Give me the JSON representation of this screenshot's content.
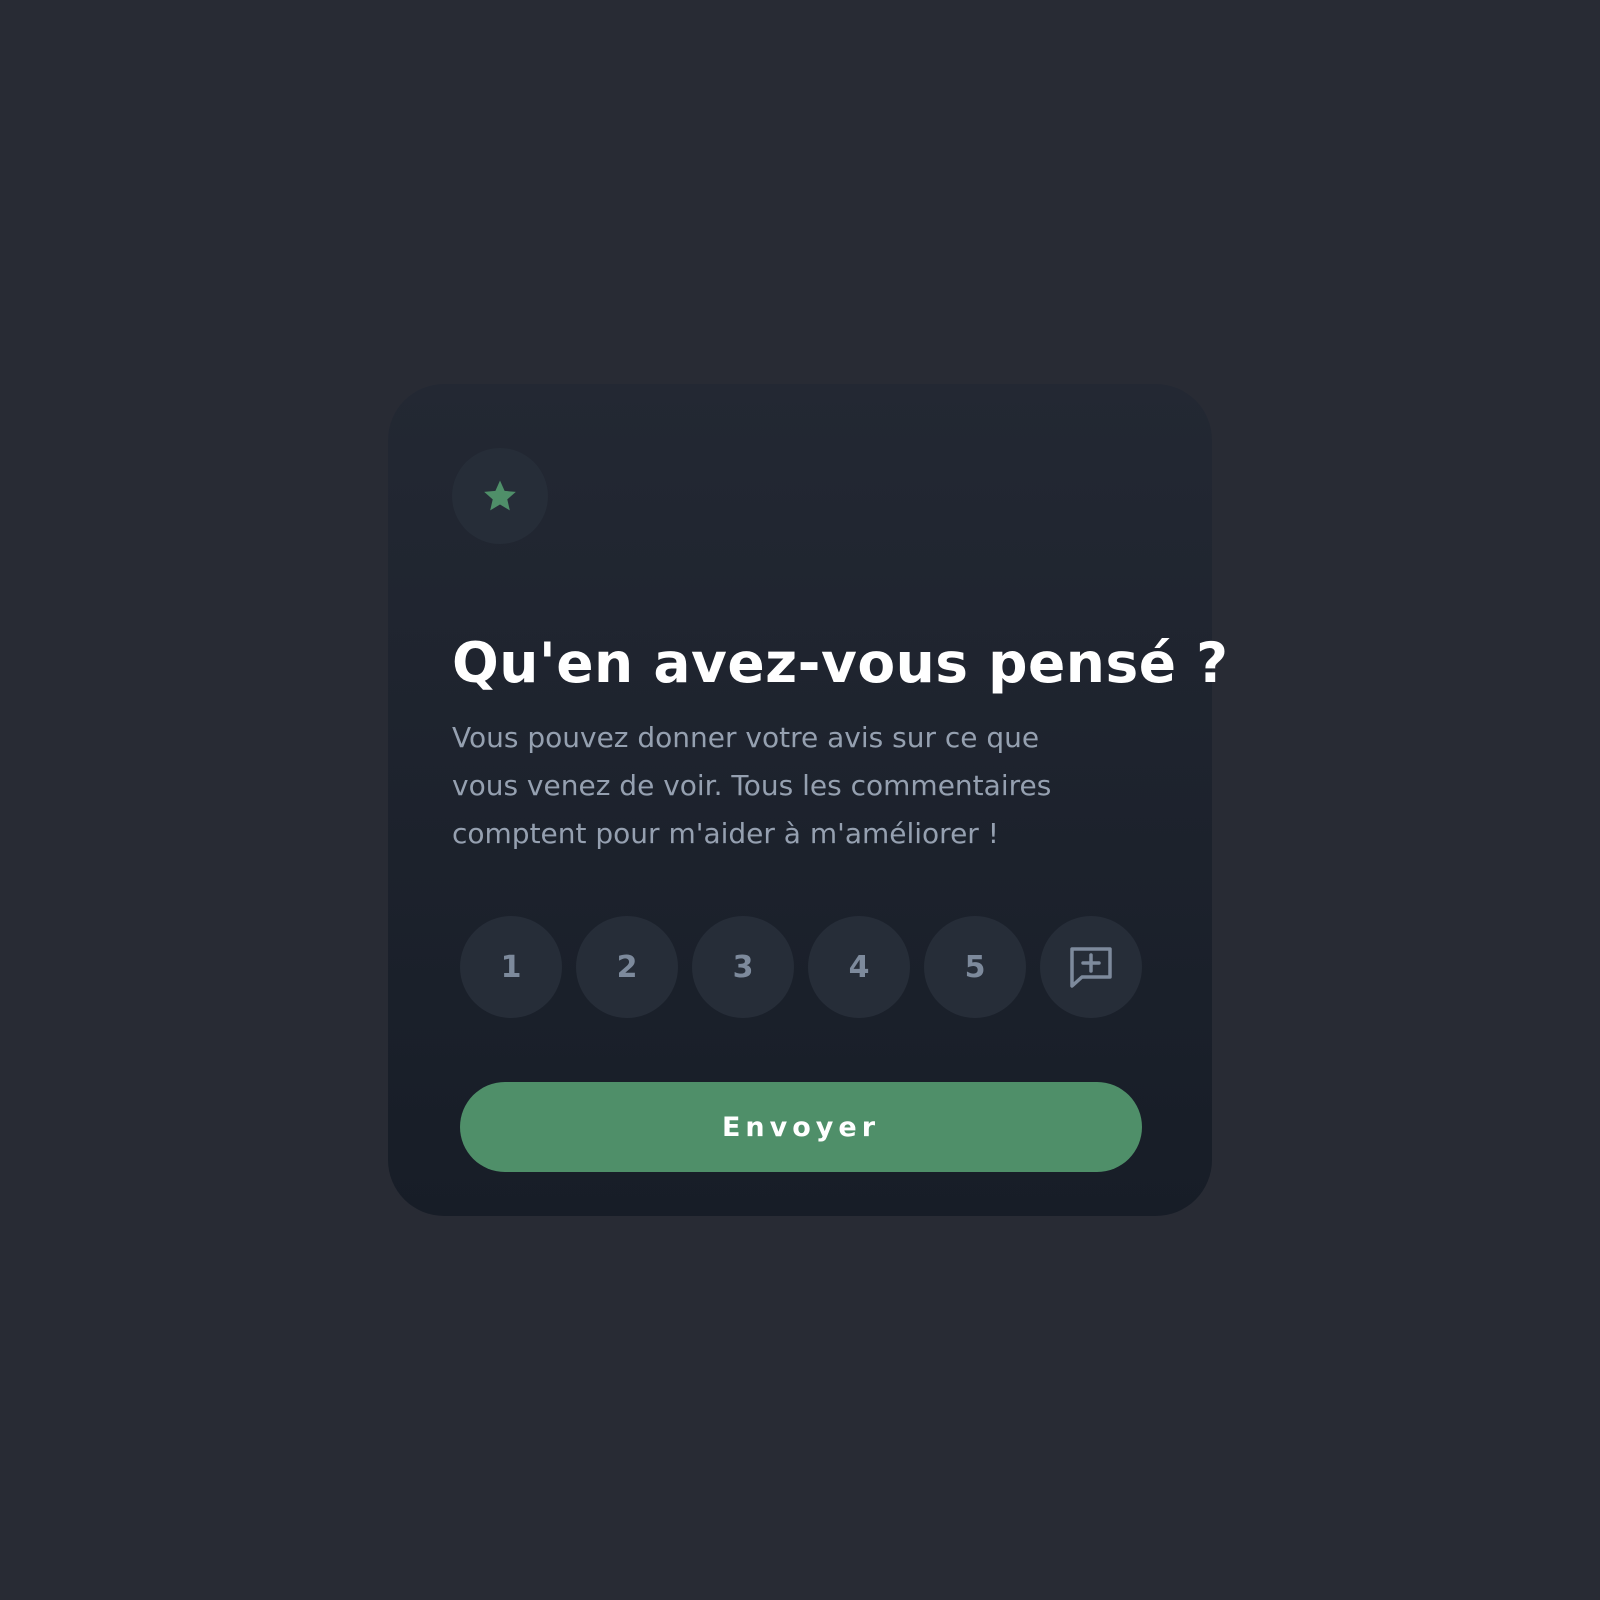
{
  "card": {
    "title": "Qu'en avez-vous pensé ?",
    "description": "Vous pouvez donner votre avis sur ce que vous venez de voir.  Tous les commentaires comptent pour m'aider à m'améliorer !",
    "icon": "star-icon"
  },
  "ratings": {
    "options": [
      "1",
      "2",
      "3",
      "4",
      "5"
    ],
    "extra_icon": "comment-add-icon"
  },
  "submit": {
    "label": "Envoyer"
  },
  "colors": {
    "page_background": "#282b34",
    "card_background_top": "#232833",
    "card_background_bottom": "#171d27",
    "accent": "#4f8f69",
    "button_background": "#262d38",
    "button_text": "#7d8a9c",
    "title_text": "#ffffff",
    "description_text": "#95a0b0"
  }
}
